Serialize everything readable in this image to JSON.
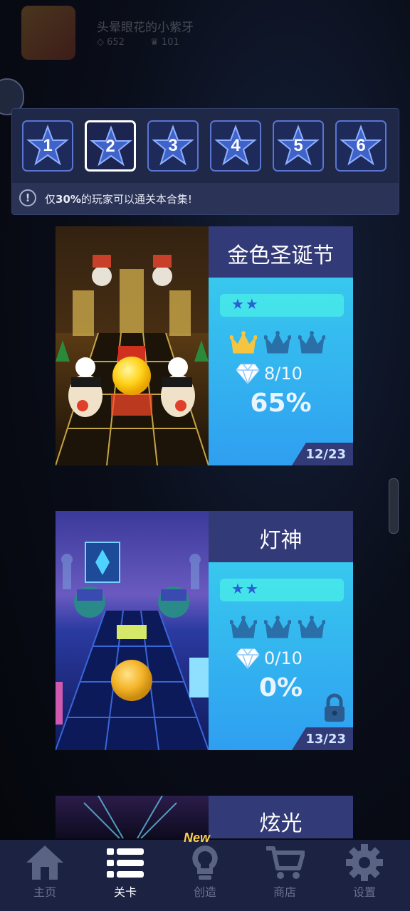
{
  "profile": {
    "username": "头晕眼花的小紫牙",
    "gems": "652",
    "crowns": "101"
  },
  "chapters": {
    "tabs": [
      "1",
      "2",
      "3",
      "4",
      "5",
      "6"
    ],
    "selected": "2",
    "notice_prefix": "仅",
    "notice_highlight": "30%",
    "notice_suffix": "的玩家可以通关本合集!"
  },
  "levels": [
    {
      "title": "金色圣诞节",
      "difficulty_stars": 2,
      "crowns_earned": 1,
      "crowns_total": 3,
      "gems": "8/10",
      "progress_percent": "65%",
      "counter": "12/23",
      "locked": false
    },
    {
      "title": "灯神",
      "difficulty_stars": 2,
      "crowns_earned": 0,
      "crowns_total": 3,
      "gems": "0/10",
      "progress_percent": "0%",
      "counter": "13/23",
      "locked": true
    },
    {
      "title": "炫光"
    }
  ],
  "nav": {
    "items": [
      {
        "label": "主页",
        "icon": "home-icon"
      },
      {
        "label": "关卡",
        "icon": "list-icon"
      },
      {
        "label": "创造",
        "icon": "lightbulb-icon"
      },
      {
        "label": "商店",
        "icon": "cart-icon"
      },
      {
        "label": "设置",
        "icon": "gear-icon"
      }
    ],
    "active": "关卡",
    "new_badge": "New"
  },
  "colors": {
    "panel": "#202848",
    "card_info": "#2f9ff0",
    "title_bar": "#333a78",
    "crown_earned": "#f5c542",
    "crown_empty": "#2a6fa8"
  }
}
